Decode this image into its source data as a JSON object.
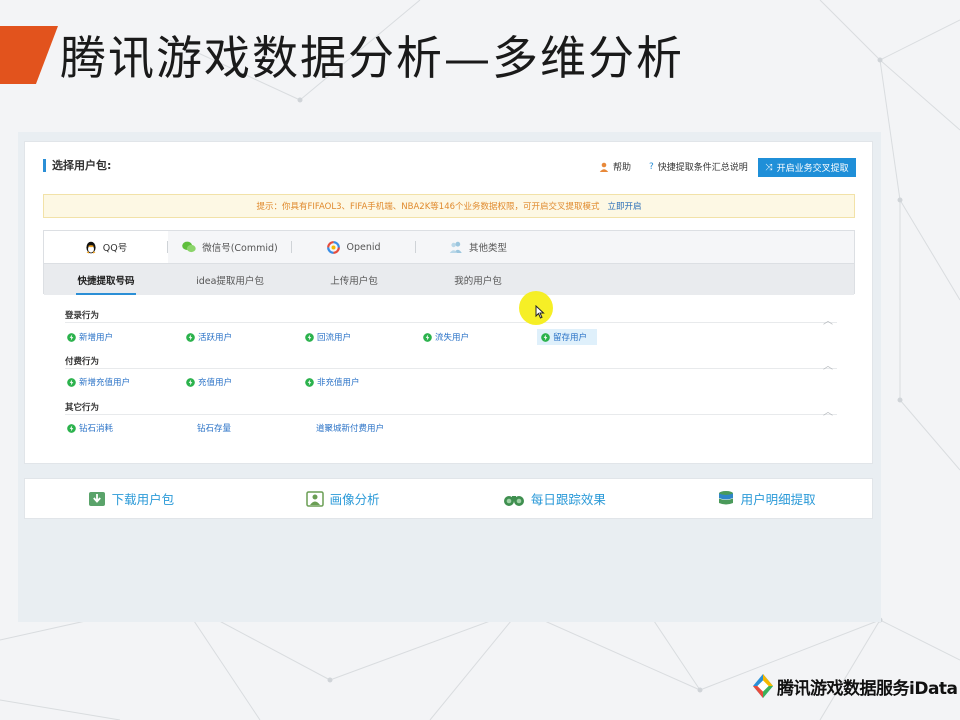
{
  "slide": {
    "title": "腾讯游戏数据分析—多维分析",
    "logo_text": "腾讯游戏数据服务iData"
  },
  "panel": {
    "title": "选择用户包:",
    "help": "帮助",
    "guide": "快捷提取条件汇总说明",
    "cross_btn": "开启业务交叉提取"
  },
  "notice": {
    "text": "提示：你具有FIFAOL3、FIFA手机端、NBA2K等146个业务数据权限，可开启交叉提取模式",
    "link": "立即开启"
  },
  "type_tabs": [
    {
      "label": "QQ号",
      "icon": "penguin-icon",
      "active": true
    },
    {
      "label": "微信号(Commid)",
      "icon": "wechat-icon",
      "active": false
    },
    {
      "label": "Openid",
      "icon": "openid-icon",
      "active": false
    },
    {
      "label": "其他类型",
      "icon": "users-icon",
      "active": false
    }
  ],
  "sub_tabs": [
    {
      "label": "快捷提取号码",
      "active": true
    },
    {
      "label": "idea提取用户包",
      "active": false
    },
    {
      "label": "上传用户包",
      "active": false
    },
    {
      "label": "我的用户包",
      "active": false
    }
  ],
  "sections": [
    {
      "title": "登录行为",
      "items": [
        {
          "label": "新增用户",
          "selected": false
        },
        {
          "label": "活跃用户",
          "selected": false
        },
        {
          "label": "回流用户",
          "selected": false
        },
        {
          "label": "流失用户",
          "selected": false
        },
        {
          "label": "留存用户",
          "selected": true
        }
      ]
    },
    {
      "title": "付费行为",
      "items": [
        {
          "label": "新增充值用户",
          "selected": false
        },
        {
          "label": "充值用户",
          "selected": false
        },
        {
          "label": "非充值用户",
          "selected": false
        }
      ]
    },
    {
      "title": "其它行为",
      "items": [
        {
          "label": "钻石消耗",
          "selected": false
        },
        {
          "label": "钻石存量",
          "selected": false
        },
        {
          "label": "道聚城新付费用户",
          "selected": false
        }
      ]
    }
  ],
  "actions": [
    {
      "label": "下载用户包",
      "icon": "download-icon"
    },
    {
      "label": "画像分析",
      "icon": "portrait-icon"
    },
    {
      "label": "每日跟踪效果",
      "icon": "binoculars-icon"
    },
    {
      "label": "用户明细提取",
      "icon": "database-icon"
    }
  ],
  "colors": {
    "accent": "#e2531d",
    "primary": "#1f8fd8",
    "link": "#2b73c7",
    "notice_text": "#e08a2e",
    "bolt": "#2bb24c"
  }
}
